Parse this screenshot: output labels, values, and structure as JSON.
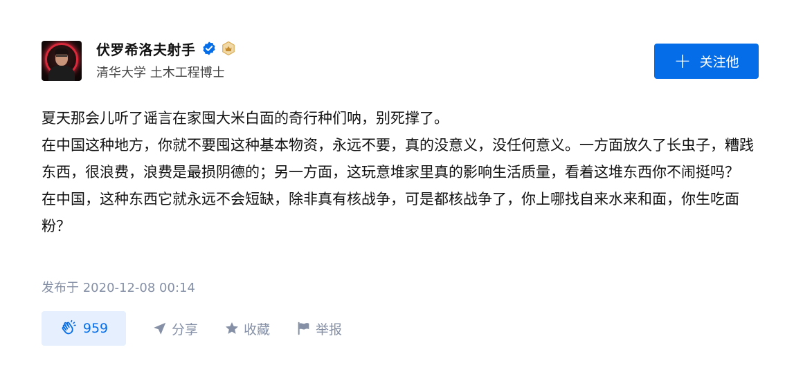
{
  "author": {
    "name": "伏罗希洛夫射手",
    "headline": "清华大学 土木工程博士"
  },
  "follow_button": {
    "label": "关注他"
  },
  "content": {
    "paragraphs": [
      "夏天那会儿听了谣言在家囤大米白面的奇行种们呐，别死撑了。",
      "在中国这种地方，你就不要囤这种基本物资，永远不要，真的没意义，没任何意义。一方面放久了长虫子，糟践东西，很浪费，浪费是最损阴德的；另一方面，这玩意堆家里真的影响生活质量，看着这堆东西你不闹挺吗？",
      "在中国，这种东西它就永远不会短缺，除非真有核战争，可是都核战争了，你上哪找自来水来和面，你生吃面粉？"
    ]
  },
  "timestamp": "发布于 2020-12-08 00:14",
  "actions": {
    "like_count": "959",
    "share_label": "分享",
    "collect_label": "收藏",
    "report_label": "举报"
  },
  "colors": {
    "primary": "#056de8",
    "like_bg": "#e5effd",
    "muted": "#8590a6"
  }
}
